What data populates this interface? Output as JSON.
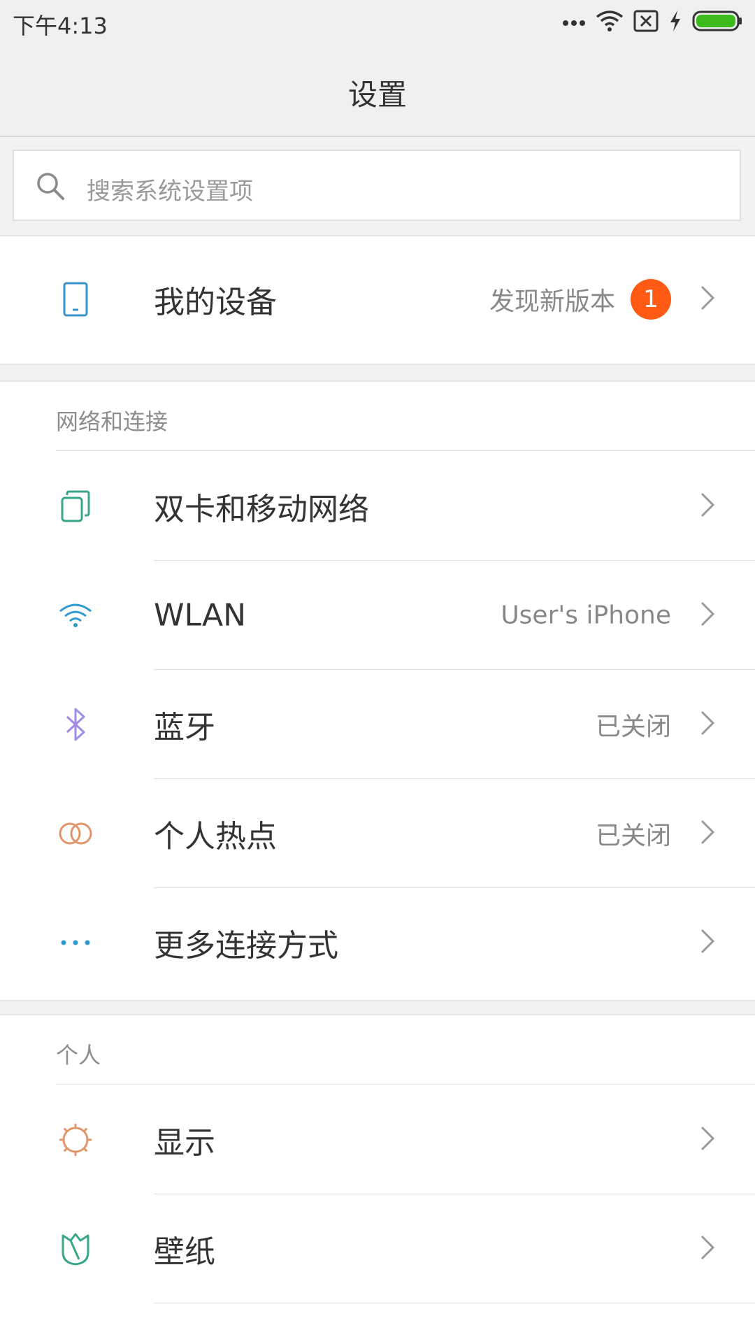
{
  "status_bar": {
    "time": "下午4:13",
    "icons": [
      "more-dots-icon",
      "wifi-icon",
      "sim-none-icon",
      "charging-bolt-icon",
      "battery-icon"
    ],
    "battery_color": "#3dbb1d"
  },
  "header": {
    "title": "设置"
  },
  "search": {
    "placeholder": "搜索系统设置项"
  },
  "device": {
    "label": "我的设备",
    "value": "发现新版本",
    "badge": "1",
    "badge_color": "#ff5a14"
  },
  "sections": {
    "network": {
      "title": "网络和连接",
      "items": [
        {
          "label": "双卡和移动网络",
          "value": "",
          "icon": "dual-sim-icon"
        },
        {
          "label": "WLAN",
          "value": "User's iPhone",
          "icon": "wifi-icon"
        },
        {
          "label": "蓝牙",
          "value": "已关闭",
          "icon": "bluetooth-icon"
        },
        {
          "label": "个人热点",
          "value": "已关闭",
          "icon": "hotspot-icon"
        },
        {
          "label": "更多连接方式",
          "value": "",
          "icon": "more-connections-icon"
        }
      ]
    },
    "personal": {
      "title": "个人",
      "items": [
        {
          "label": "显示",
          "value": "",
          "icon": "display-sun-icon"
        },
        {
          "label": "壁纸",
          "value": "",
          "icon": "wallpaper-icon"
        }
      ]
    }
  }
}
